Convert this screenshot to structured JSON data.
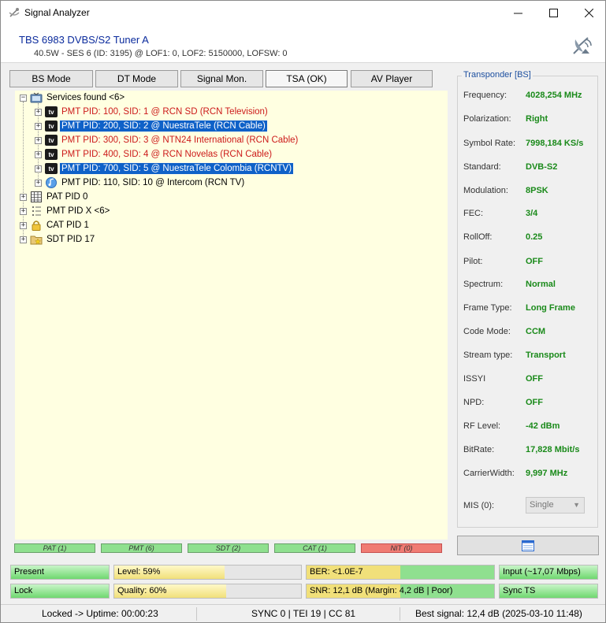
{
  "window": {
    "title": "Signal Analyzer"
  },
  "device": {
    "name": "TBS 6983 DVBS/S2 Tuner A",
    "details": "40.5W - SES 6 (ID: 3195) @ LOF1: 0, LOF2: 5150000, LOFSW: 0"
  },
  "tabs": [
    {
      "label": "BS Mode"
    },
    {
      "label": "DT Mode"
    },
    {
      "label": "Signal Mon."
    },
    {
      "label": "TSA (OK)"
    },
    {
      "label": "AV Player"
    }
  ],
  "tree": {
    "root": "Services found <6>",
    "services": [
      {
        "label": "PMT PID: 100, SID: 1 @ RCN SD (RCN Television)",
        "style": "red"
      },
      {
        "label": "PMT PID: 200, SID: 2 @ NuestraTele (RCN Cable)",
        "style": "selected"
      },
      {
        "label": "PMT PID: 300, SID: 3 @ NTN24 International (RCN Cable)",
        "style": "red"
      },
      {
        "label": "PMT PID: 400, SID: 4 @ RCN Novelas (RCN Cable)",
        "style": "red"
      },
      {
        "label": "PMT PID: 700, SID: 5 @ NuestraTele Colombia (RCNTV)",
        "style": "selected"
      },
      {
        "label": "PMT PID: 110, SID: 10 @ Intercom (RCN TV)",
        "style": "normal"
      }
    ],
    "tables": [
      {
        "label": "PAT PID 0",
        "icon": "table-grid-icon"
      },
      {
        "label": "PMT PID X <6>",
        "icon": "list-icon"
      },
      {
        "label": "CAT PID 1",
        "icon": "lock-icon"
      },
      {
        "label": "SDT PID 17",
        "icon": "folder-star-icon"
      }
    ]
  },
  "pid_status": [
    {
      "label": "PAT (1)",
      "ok": true
    },
    {
      "label": "PMT (6)",
      "ok": true
    },
    {
      "label": "SDT (2)",
      "ok": true
    },
    {
      "label": "CAT (1)",
      "ok": true
    },
    {
      "label": "NIT (0)",
      "ok": false
    }
  ],
  "transponder": {
    "title": "Transponder [BS]",
    "props": [
      {
        "key": "Frequency:",
        "value": "4028,254 MHz"
      },
      {
        "key": "Polarization:",
        "value": "Right"
      },
      {
        "key": "Symbol Rate:",
        "value": "7998,184 KS/s"
      },
      {
        "key": "Standard:",
        "value": "DVB-S2"
      },
      {
        "key": "Modulation:",
        "value": "8PSK"
      },
      {
        "key": "FEC:",
        "value": "3/4"
      },
      {
        "key": "RollOff:",
        "value": "0.25"
      },
      {
        "key": "Pilot:",
        "value": "OFF"
      },
      {
        "key": "Spectrum:",
        "value": "Normal"
      },
      {
        "key": "Frame Type:",
        "value": "Long Frame"
      },
      {
        "key": "Code Mode:",
        "value": "CCM"
      },
      {
        "key": "Stream type:",
        "value": "Transport"
      },
      {
        "key": "ISSYI",
        "value": "OFF"
      },
      {
        "key": "NPD:",
        "value": "OFF"
      },
      {
        "key": "RF Level:",
        "value": "-42 dBm"
      },
      {
        "key": "BitRate:",
        "value": "17,828 Mbit/s"
      },
      {
        "key": "CarrierWidth:",
        "value": "9,997 MHz"
      }
    ],
    "mis_label": "MIS (0):",
    "mis_value": "Single"
  },
  "meters": {
    "present": {
      "label": "Present"
    },
    "lock": {
      "label": "Lock"
    },
    "level": {
      "label": "Level: 59%",
      "percent": 59
    },
    "quality": {
      "label": "Quality: 60%",
      "percent": 60
    },
    "ber": {
      "label": "BER: <1.0E-7"
    },
    "snr": {
      "label": "SNR: 12,1 dB (Margin: 4,2 dB | Poor)"
    },
    "input": {
      "label": "Input (~17,07 Mbps)"
    },
    "sync": {
      "label": "Sync TS"
    }
  },
  "statusbar": {
    "uptime": "Locked -> Uptime: 00:00:23",
    "sync": "SYNC 0 | TEI 19 | CC 81",
    "best": "Best signal: 12,4 dB (2025-03-10 11:48)"
  },
  "colors": {
    "ok": "#8fe08f",
    "bad": "#f07b73",
    "value_green": "#1a8a1a",
    "selection": "#0f61c8"
  }
}
